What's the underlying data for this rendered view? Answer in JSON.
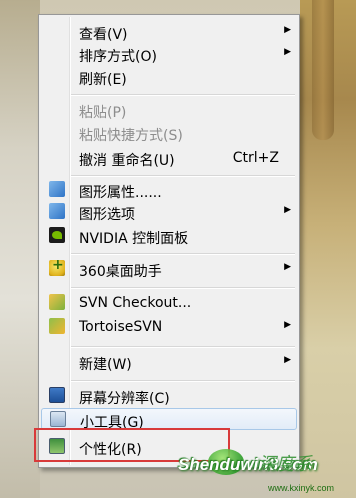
{
  "menu": {
    "items": [
      {
        "label": "查看(V)",
        "submenu": true
      },
      {
        "label": "排序方式(O)",
        "submenu": true
      },
      {
        "label": "刷新(E)"
      },
      {
        "label": "粘贴(P)",
        "disabled": true
      },
      {
        "label": "粘贴快捷方式(S)",
        "disabled": true
      },
      {
        "label": "撤消 重命名(U)",
        "shortcut": "Ctrl+Z"
      },
      {
        "label": "图形属性......",
        "icon": "graphics-properties-icon"
      },
      {
        "label": "图形选项",
        "icon": "graphics-options-icon",
        "submenu": true
      },
      {
        "label": "NVIDIA 控制面板",
        "icon": "nvidia-icon"
      },
      {
        "label": "360桌面助手",
        "icon": "360-icon",
        "submenu": true
      },
      {
        "label": "SVN Checkout...",
        "icon": "svn-checkout-icon"
      },
      {
        "label": "TortoiseSVN",
        "icon": "tortoisesvn-icon",
        "submenu": true
      },
      {
        "label": "新建(W)",
        "submenu": true
      },
      {
        "label": "屏幕分辨率(C)",
        "icon": "screen-resolution-icon"
      },
      {
        "label": "小工具(G)",
        "icon": "gadgets-icon",
        "hovered": true
      },
      {
        "label": "个性化(R)",
        "icon": "personalize-icon",
        "highlighted": true
      }
    ],
    "arrow_glyph": "▶"
  },
  "watermark": {
    "brand": "Shenduwin8.com",
    "decor": "深度系",
    "url": "www.kxinyk.com"
  },
  "colors": {
    "highlight_border": "#d83a3a",
    "menu_bg": "#f0f0f0",
    "hover_bg": "#e2ecf8",
    "disabled_text": "#8d8d8d"
  }
}
